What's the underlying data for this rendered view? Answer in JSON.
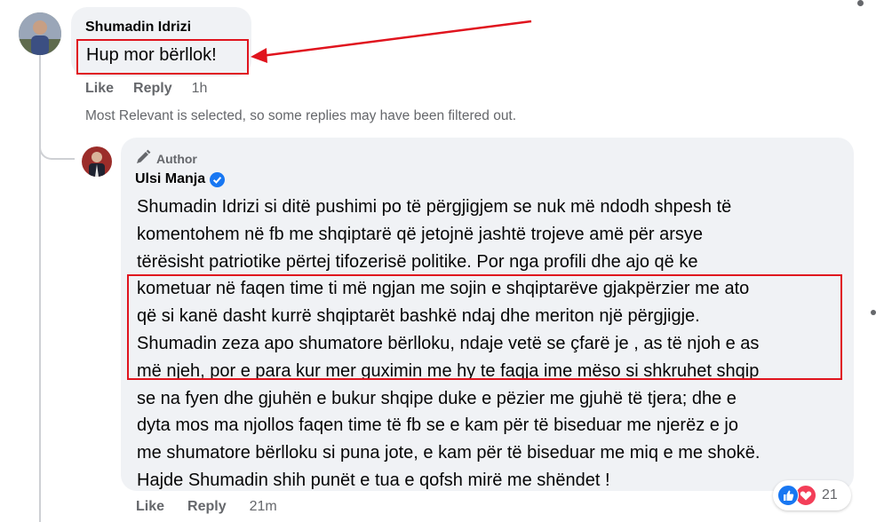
{
  "comment1": {
    "author": "Shumadin Idrizi",
    "text": "Hup mor bërllok!",
    "like_label": "Like",
    "reply_label": "Reply",
    "time": "1h",
    "avatar_icon": "user-photo"
  },
  "filter_notice": "Most Relevant is selected, so some replies may have been filtered out.",
  "reply": {
    "badge_icon": "pencil-icon",
    "badge_label": "Author",
    "author": "Ulsi Manja",
    "verified_icon": "verified-check-icon",
    "lines": [
      "Shumadin Idrizi si ditë pushimi po të përgjigjem se nuk më ndodh shpesh të",
      "komentohem në fb me shqiptarë që jetojnë jashtë trojeve amë për arsye",
      "tërësisht patriotike përtej tifozerisë politike. Por nga profili dhe ajo që ke",
      "kometuar në faqen time ti më ngjan me sojin e shqiptarëve gjakpërzier me ato",
      "që si kanë dasht kurrë shqiptarët bashkë ndaj dhe meriton një përgjigje.",
      "Shumadin zeza apo shumatore bërlloku, ndaje vetë se çfarë je , as të njoh e as",
      "më njeh, por e para kur mer guximin me hy te faqja ime mëso si shkruhet shqip",
      "se na fyen dhe gjuhën e bukur shqipe duke e pëzier me gjuhë të tjera; dhe e",
      "dyta mos ma njollos faqen time të fb se e kam për të biseduar me njerëz e jo",
      "me shumatore bërlloku si puna jote, e kam për të biseduar me miq e me shokë.",
      "Hajde Shumadin shih punët e tua e qofsh mirë me shëndet !"
    ],
    "like_label": "Like",
    "reply_label": "Reply",
    "time": "21m",
    "reaction_icons": [
      "like-reaction-icon",
      "love-reaction-icon"
    ],
    "reaction_count": "21"
  },
  "colors": {
    "annotation_red": "#e0141e",
    "bubble_bg": "#f0f2f5",
    "meta_grey": "#65676b",
    "verified_blue": "#1877f2"
  }
}
